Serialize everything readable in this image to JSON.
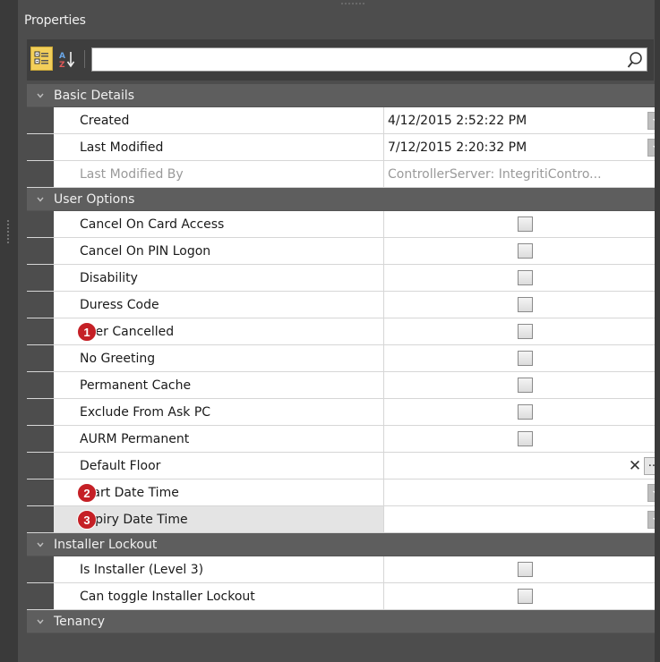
{
  "panel": {
    "title": "Properties"
  },
  "toolbar": {
    "categorized_icon": "categorized-view-icon",
    "alphabetical_icon": "sort-alphabetical-icon",
    "search": {
      "value": "",
      "placeholder": "",
      "icon": "search-icon"
    }
  },
  "categories": {
    "basic": {
      "label": "Basic Details",
      "created": {
        "name": "Created",
        "value": "4/12/2015 2:52:22 PM"
      },
      "last_modified": {
        "name": "Last Modified",
        "value": "7/12/2015 2:20:32 PM"
      },
      "last_modified_by": {
        "name": "Last Modified By",
        "value": "ControllerServer: IntegritiContro..."
      }
    },
    "user_options": {
      "label": "User Options",
      "items": [
        {
          "name": "Cancel On Card Access",
          "checked": false
        },
        {
          "name": "Cancel On PIN Logon",
          "checked": false
        },
        {
          "name": "Disability",
          "checked": false
        },
        {
          "name": "Duress Code",
          "checked": false
        },
        {
          "name": "User Cancelled",
          "checked": false
        },
        {
          "name": "No Greeting",
          "checked": false
        },
        {
          "name": "Permanent Cache",
          "checked": false
        },
        {
          "name": "Exclude From Ask PC",
          "checked": false
        },
        {
          "name": "AURM Permanent",
          "checked": false
        }
      ],
      "default_floor": {
        "name": "Default Floor",
        "value": "",
        "clear_label": "✕",
        "ellipsis_label": "···"
      },
      "start_date_time": {
        "name": "Start Date Time",
        "value": ""
      },
      "expiry_date_time": {
        "name": "Expiry Date Time",
        "value": ""
      }
    },
    "installer": {
      "label": "Installer Lockout",
      "items": [
        {
          "name": "Is Installer (Level 3)",
          "checked": false
        },
        {
          "name": "Can toggle Installer Lockout",
          "checked": false
        }
      ]
    },
    "tenancy": {
      "label": "Tenancy"
    }
  },
  "markers": [
    "1",
    "2",
    "3"
  ],
  "colors": {
    "marker": "#c52026",
    "category_bg": "#5e5e5e",
    "panel_bg": "#4d4d4d",
    "toolbar_active": "#f2cf5a"
  }
}
